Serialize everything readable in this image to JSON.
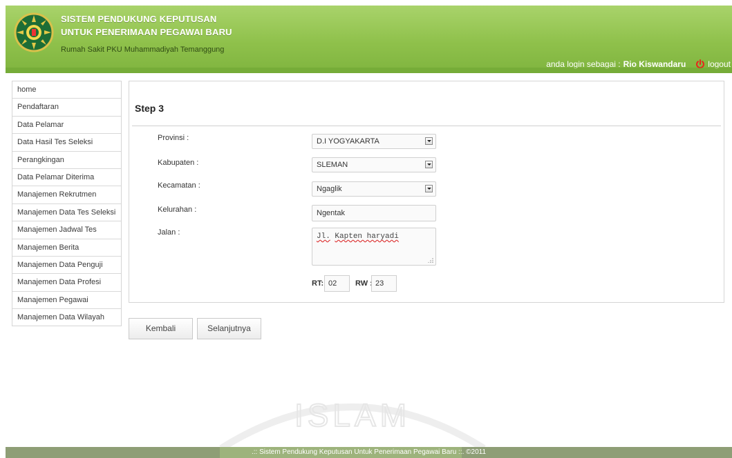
{
  "header": {
    "title_line1": "SISTEM PENDUKUNG KEPUTUSAN",
    "title_line2": "UNTUK PENERIMAAN PEGAWAI BARU",
    "subtitle": "Rumah Sakit PKU Muhammadiyah Temanggung",
    "login_prefix": "anda login sebagai :",
    "user_name": "Rio Kiswandaru",
    "logout_label": "logout"
  },
  "sidebar": {
    "items": [
      {
        "label": "home"
      },
      {
        "label": "Pendaftaran"
      },
      {
        "label": "Data Pelamar"
      },
      {
        "label": "Data Hasil Tes Seleksi"
      },
      {
        "label": "Perangkingan"
      },
      {
        "label": "Data Pelamar Diterima"
      },
      {
        "label": "Manajemen Rekrutmen"
      },
      {
        "label": "Manajemen Data Tes Seleksi"
      },
      {
        "label": "Manajemen Jadwal Tes"
      },
      {
        "label": "Manajemen Berita"
      },
      {
        "label": "Manajemen Data Penguji"
      },
      {
        "label": "Manajemen Data Profesi"
      },
      {
        "label": "Manajemen Pegawai"
      },
      {
        "label": "Manajemen Data Wilayah"
      }
    ]
  },
  "form": {
    "step_title": "Step 3",
    "provinsi": {
      "label": "Provinsi :",
      "value": "D.I YOGYAKARTA"
    },
    "kabupaten": {
      "label": "Kabupaten :",
      "value": "SLEMAN"
    },
    "kecamatan": {
      "label": "Kecamatan :",
      "value": "Ngaglik"
    },
    "kelurahan": {
      "label": "Kelurahan :",
      "value": "Ngentak"
    },
    "jalan": {
      "label": "Jalan :",
      "value_prefix": "Jl.",
      "value_rest": "Kapten haryadi"
    },
    "rt": {
      "label": "RT:",
      "value": "02"
    },
    "rw": {
      "label": "RW :",
      "value": "23"
    }
  },
  "buttons": {
    "back_label": "Kembali",
    "next_label": "Selanjutnya"
  },
  "watermark_text": "ISLAM",
  "footer": {
    "text": ".:: Sistem Pendukung Keputusan Untuk Penerimaan Pegawai Baru ::. ©2011"
  },
  "colors": {
    "header_green": "#8fc14b",
    "footer_olive": "#8e9e76",
    "logout_icon_red": "#e8261c"
  },
  "icons": {
    "logo": "hospital-emblem-icon",
    "logout": "power-icon",
    "select": "dropdown-arrow-icon",
    "resize": "resize-grip-icon"
  }
}
